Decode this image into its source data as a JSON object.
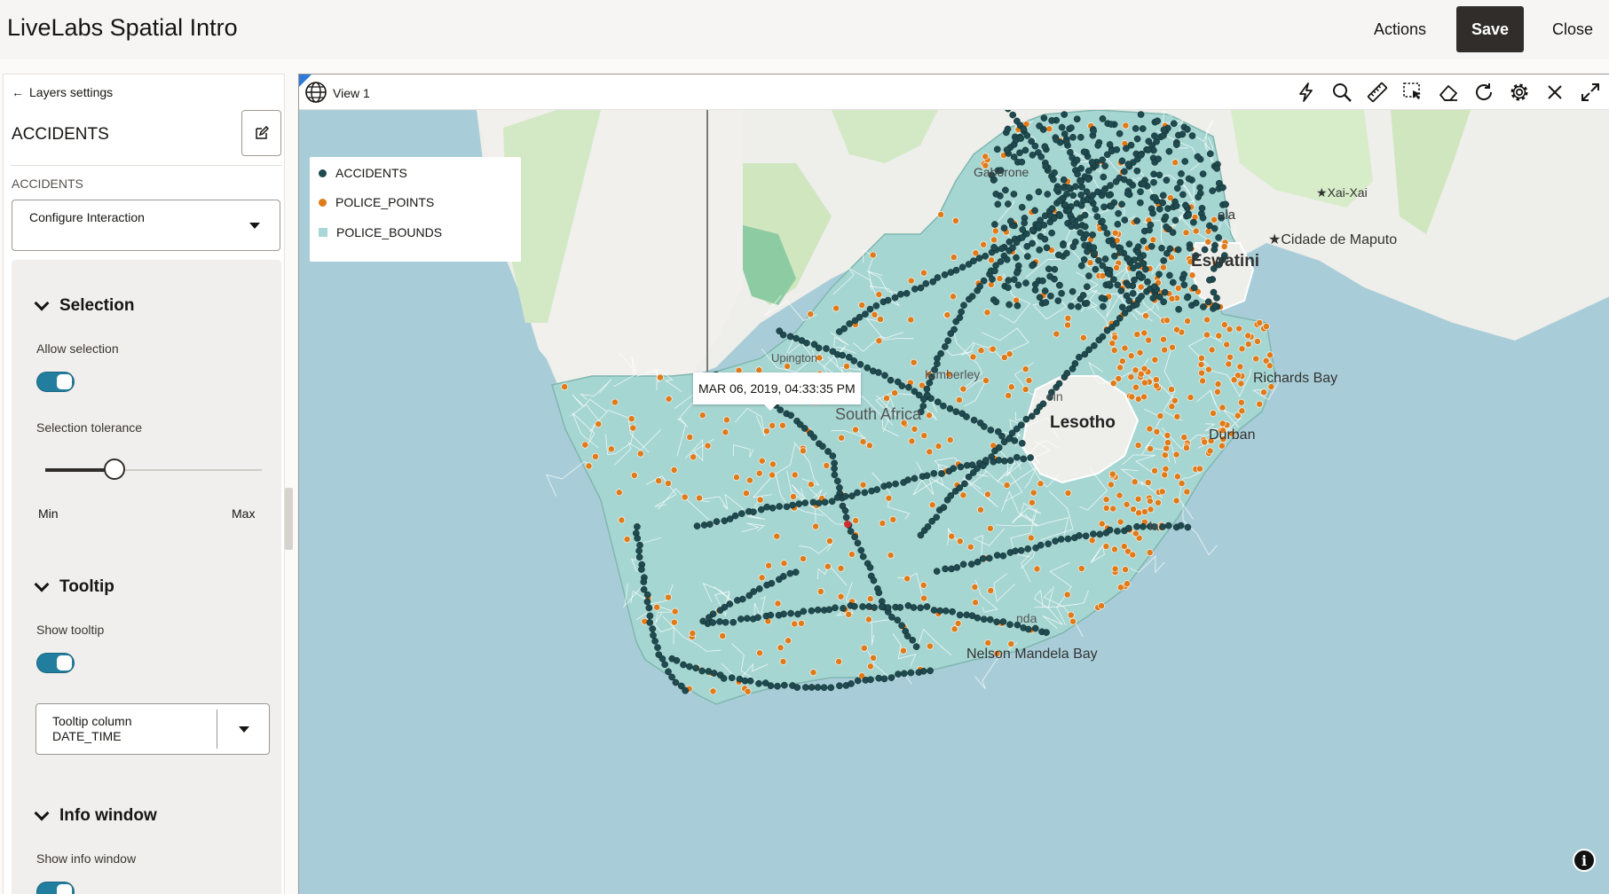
{
  "app": {
    "title": "LiveLabs Spatial Intro"
  },
  "header": {
    "actions_label": "Actions",
    "save_label": "Save",
    "close_label": "Close"
  },
  "panel": {
    "back_label": "Layers settings",
    "layer_title": "ACCIDENTS",
    "section_caption": "ACCIDENTS",
    "configure_select": "Configure Interaction",
    "selection": {
      "title": "Selection",
      "allow_label": "Allow selection",
      "allow_on": true,
      "tolerance_label": "Selection tolerance",
      "tolerance_value": 0.32,
      "min_label": "Min",
      "max_label": "Max"
    },
    "tooltip": {
      "title": "Tooltip",
      "show_label": "Show tooltip",
      "show_on": true,
      "column_label": "Tooltip column",
      "column_value": "DATE_TIME"
    },
    "info_window": {
      "title": "Info window",
      "show_label": "Show info window"
    }
  },
  "map": {
    "view_label": "View 1",
    "tools": [
      "lightning-icon",
      "search-icon",
      "ruler-icon",
      "select-area-icon",
      "eraser-icon",
      "refresh-icon",
      "gear-icon",
      "close-icon",
      "expand-icon"
    ],
    "legend": [
      {
        "label": "ACCIDENTS",
        "color": "#1f4a4f",
        "shape": "dot"
      },
      {
        "label": "POLICE_POINTS",
        "color": "#e07b1a",
        "shape": "dot"
      },
      {
        "label": "POLICE_BOUNDS",
        "color": "#a9d6d6",
        "shape": "square"
      }
    ],
    "tooltip_text": "MAR 06, 2019, 04:33:35 PM",
    "place_labels": {
      "gaborone": "Gaborone",
      "xai_xai": "Xai-Xai",
      "maputo": "Cidade de Maputo",
      "eswatini": "Eswatini",
      "richards_bay": "Richards Bay",
      "lesotho": "Lesotho",
      "durban": "Durban",
      "nelson_mandela_bay": "Nelson Mandela Bay",
      "south_africa": "South Africa",
      "upington": "Upington",
      "kimberley": "Kimberley",
      "bloemfontein": "ein",
      "la": "la",
      "ela": "ela",
      "nda": "nda"
    },
    "info_icon": "i"
  }
}
